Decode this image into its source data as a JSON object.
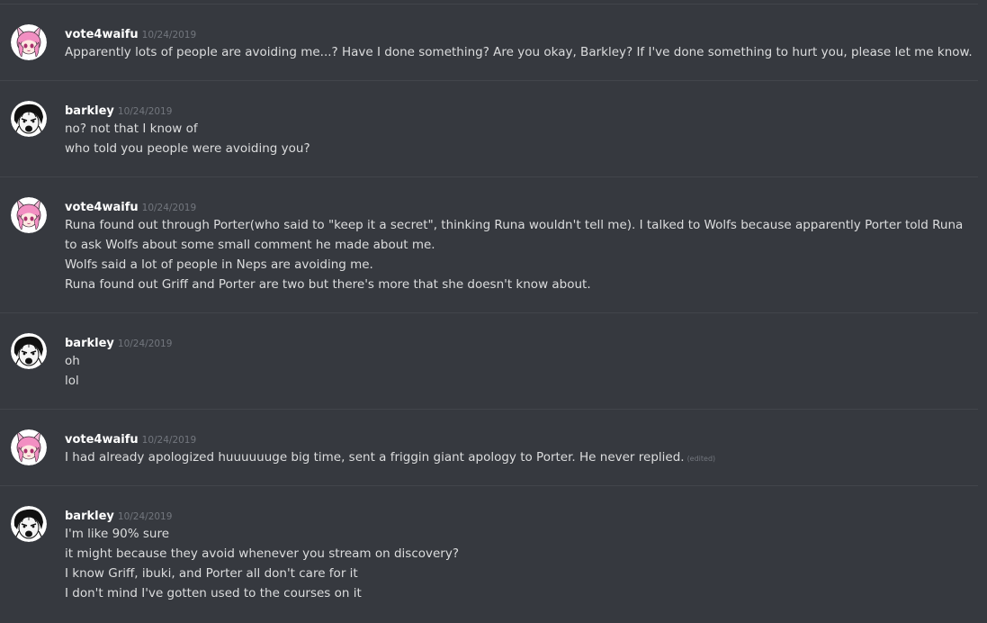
{
  "colors": {
    "background": "#36393f",
    "divider": "#42454b",
    "username": "#ffffff",
    "text": "#dcddde",
    "muted": "#72767d"
  },
  "messages": [
    {
      "author": "vote4waifu",
      "avatar": "pink-anime-girl-avatar",
      "timestamp": "10/24/2019",
      "lines": [
        "Apparently lots of people are avoiding me...? Have I done something? Are you okay, Barkley? If I've done something to hurt you, please let me know."
      ]
    },
    {
      "author": "barkley",
      "avatar": "manga-face-avatar",
      "timestamp": "10/24/2019",
      "lines": [
        "no? not that I know of",
        "who told you people were avoiding you?"
      ]
    },
    {
      "author": "vote4waifu",
      "avatar": "pink-anime-girl-avatar",
      "timestamp": "10/24/2019",
      "lines": [
        "Runa found out through Porter(who said to \"keep it a secret\", thinking Runa wouldn't tell me). I talked to Wolfs because apparently Porter told Runa",
        "to ask Wolfs about some small comment he made about me.",
        "Wolfs said a lot of people in Neps are avoiding me.",
        "Runa found out Griff and Porter are two but there's more that she doesn't know about."
      ]
    },
    {
      "author": "barkley",
      "avatar": "manga-face-avatar",
      "timestamp": "10/24/2019",
      "lines": [
        "oh",
        "lol"
      ]
    },
    {
      "author": "vote4waifu",
      "avatar": "pink-anime-girl-avatar",
      "timestamp": "10/24/2019",
      "lines": [
        "I had already apologized huuuuuuge big time, sent a friggin giant apology to Porter. He never replied."
      ],
      "edited_label": "(edited)"
    },
    {
      "author": "barkley",
      "avatar": "manga-face-avatar",
      "timestamp": "10/24/2019",
      "lines": [
        "I'm like 90% sure",
        "it might because they avoid whenever you stream on discovery?",
        "I know Griff, ibuki, and Porter all don't care for it",
        "I don't mind I've gotten used to the courses on it"
      ]
    }
  ]
}
